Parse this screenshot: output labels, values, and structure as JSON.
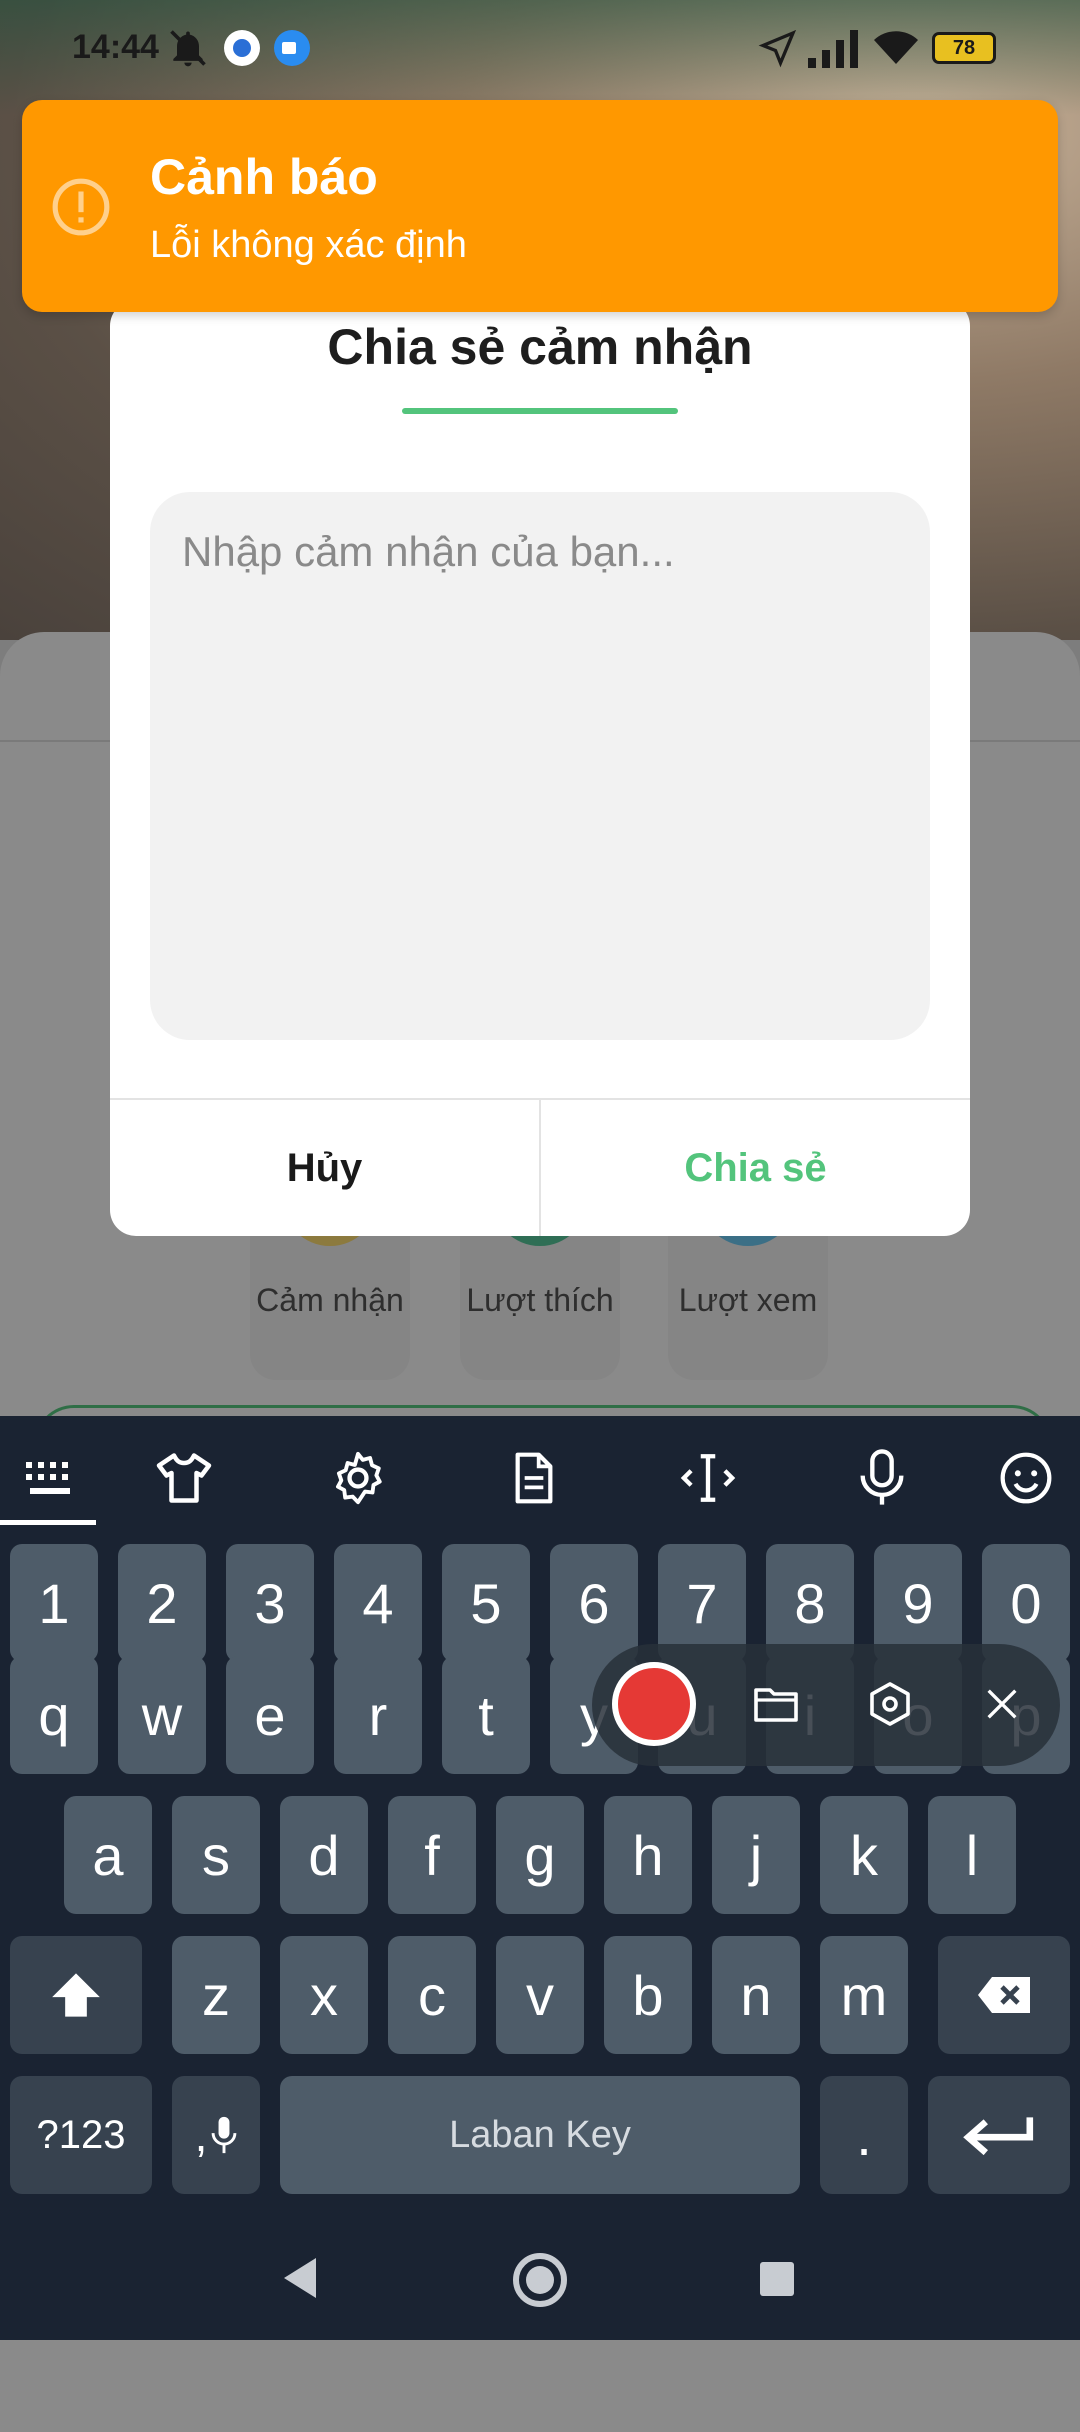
{
  "status_bar": {
    "time": "14:44",
    "battery": "78"
  },
  "background": {
    "stats": [
      {
        "label": "Cảm nhận",
        "color": "#c9a032"
      },
      {
        "label": "Lượt thích",
        "color": "#2f9a6a"
      },
      {
        "label": "Lượt xem",
        "color": "#3a9ac0"
      }
    ]
  },
  "toast": {
    "title": "Cảnh báo",
    "message": "Lỗi không xác định",
    "color": "#ff9800"
  },
  "dialog": {
    "title": "Chia sẻ cảm nhận",
    "placeholder": "Nhập cảm nhận của bạn...",
    "cancel_label": "Hủy",
    "share_label": "Chia sẻ",
    "accent": "#53c47c"
  },
  "keyboard": {
    "toolbar_icons": [
      "keyboard-icon",
      "shirt-icon",
      "gear-icon",
      "document-icon",
      "cursor-icon",
      "microphone-icon",
      "emoji-icon"
    ],
    "number_row": [
      "1",
      "2",
      "3",
      "4",
      "5",
      "6",
      "7",
      "8",
      "9",
      "0"
    ],
    "row1": [
      "q",
      "w",
      "e",
      "r",
      "t",
      "y",
      "u",
      "i",
      "o",
      "p"
    ],
    "row2": [
      "a",
      "s",
      "d",
      "f",
      "g",
      "h",
      "j",
      "k",
      "l"
    ],
    "row3": [
      "z",
      "x",
      "c",
      "v",
      "b",
      "n",
      "m"
    ],
    "symbols_label": "?123",
    "comma_label": ",",
    "space_label": "Laban Key",
    "period_label": "."
  }
}
